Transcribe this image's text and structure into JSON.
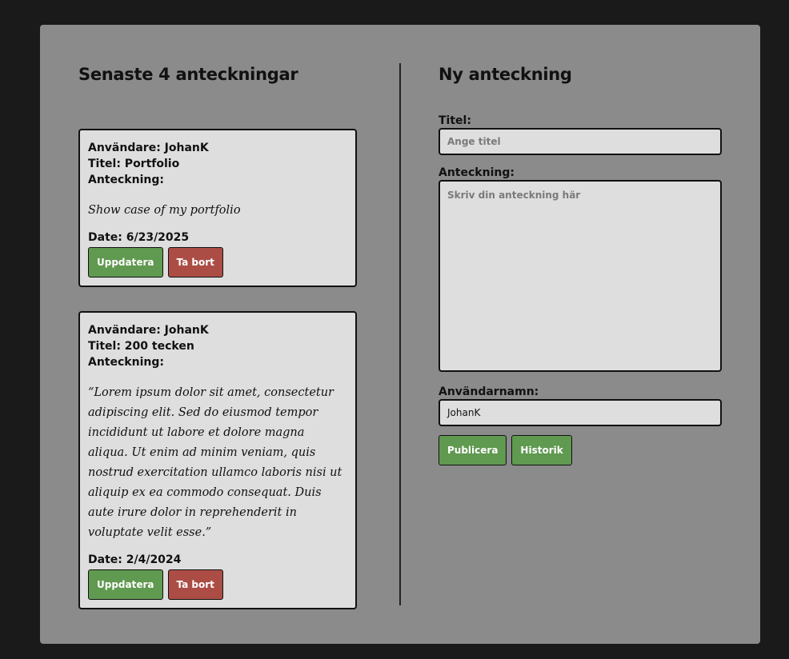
{
  "notes_section": {
    "title": "Senaste 4 anteckningar",
    "notes": [
      {
        "user": "Användare: JohanK",
        "title": "Titel: Portfolio",
        "note_label": "Anteckning:",
        "body": "Show case of my portfolio",
        "date": "Date: 6/23/2025",
        "update_label": "Uppdatera",
        "delete_label": "Ta bort"
      },
      {
        "user": "Användare: JohanK",
        "title": "Titel: 200 tecken",
        "note_label": "Anteckning:",
        "body": "“Lorem ipsum dolor sit amet, consectetur adipiscing elit. Sed do eiusmod tempor incididunt ut labore et dolore magna aliqua. Ut enim ad minim veniam, quis nostrud exercitation ullamco laboris nisi ut aliquip ex ea commodo consequat. Duis aute irure dolor in reprehenderit in voluptate velit esse.”",
        "date": "Date: 2/4/2024",
        "update_label": "Uppdatera",
        "delete_label": "Ta bort"
      }
    ]
  },
  "new_note": {
    "title": "Ny anteckning",
    "title_label": "Titel:",
    "title_placeholder": "Ange titel",
    "note_label": "Anteckning:",
    "note_placeholder": "Skriv din anteckning här",
    "username_label": "Användarnamn:",
    "username_value": "JohanK",
    "publish_label": "Publicera",
    "history_label": "Historik"
  },
  "colors": {
    "page_background": "#1a1a1a",
    "panel_background": "#8c8b8c",
    "card_background": "#dedede",
    "button_green": "#609950",
    "button_red": "#ac4d45"
  }
}
